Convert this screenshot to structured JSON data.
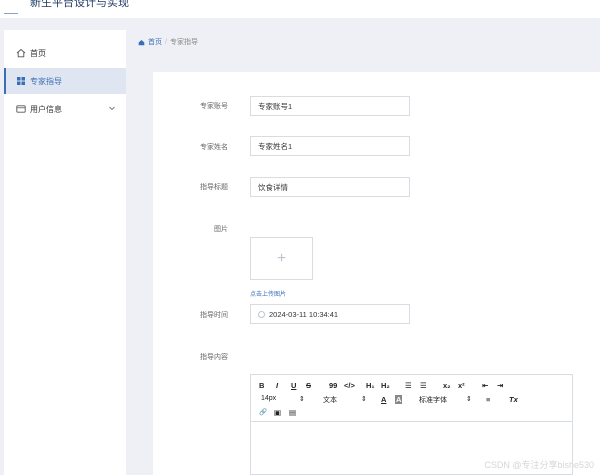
{
  "header": {
    "title": "新生平台设计与实现"
  },
  "sidebar": {
    "items": [
      {
        "label": "首页"
      },
      {
        "label": "专家指导"
      },
      {
        "label": "用户信息"
      }
    ]
  },
  "breadcrumb": {
    "home": "首页",
    "separator": "/",
    "current": "专家指导"
  },
  "form": {
    "account_label": "专家账号",
    "account_value": "专家账号1",
    "name_label": "专家姓名",
    "name_value": "专家姓名1",
    "title_label": "指导标题",
    "title_value": "饮食详情",
    "image_label": "图片",
    "upload_plus": "+",
    "upload_hint": "点击上传图片",
    "time_label": "指导时间",
    "time_value": "2024-03-11 10:34:41",
    "content_label": "指导内容"
  },
  "editor": {
    "bold": "B",
    "italic": "I",
    "underline": "U",
    "strike": "S",
    "quote": "99",
    "code": "</>",
    "h1": "H₁",
    "h2": "H₂",
    "ol": "☰",
    "ul": "☰",
    "sub": "x₂",
    "sup": "x²",
    "indent_out": "⇤",
    "indent_in": "⇥",
    "size_select": "14px",
    "size_arrow": "⇕",
    "type_select": "文本",
    "type_arrow": "⇕",
    "font_color": "A",
    "bg_color": "A",
    "font_select": "标准字体",
    "font_arrow": "⇕",
    "align": "≡",
    "clear": "Tx",
    "link": "🔗",
    "image": "▣",
    "video": "▤"
  },
  "watermark": "CSDN @专注分享bishe530",
  "colors": {
    "accent": "#3a6fb8",
    "sidebar_active_bg": "#dfe6f1",
    "page_bg": "#eef0f5"
  }
}
